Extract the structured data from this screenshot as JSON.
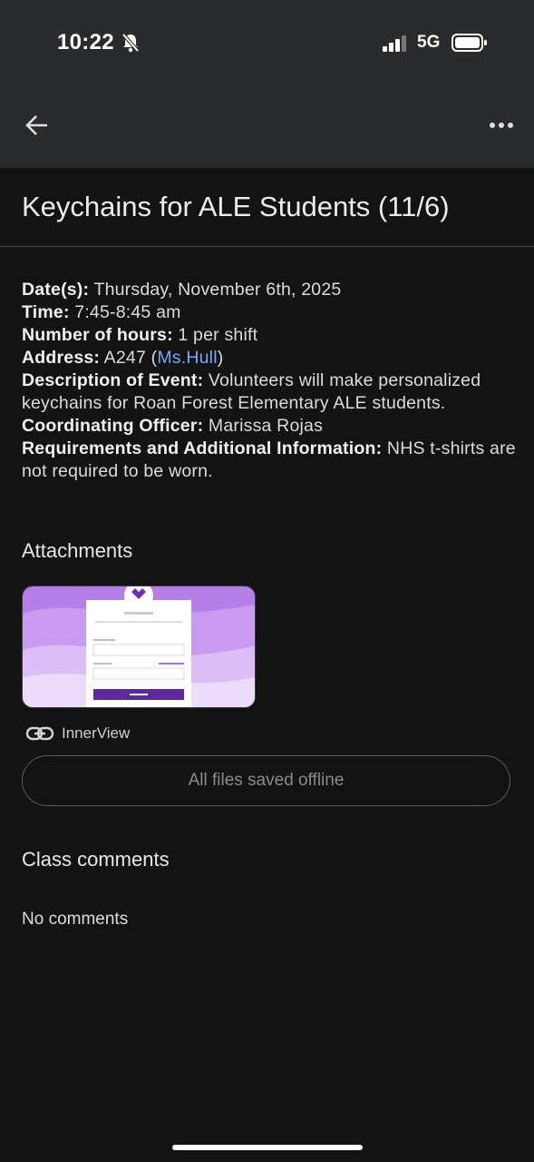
{
  "status_bar": {
    "time": "10:22",
    "network": "5G"
  },
  "header": {
    "back_icon": "arrow-left-icon",
    "more_icon": "more-horiz-icon"
  },
  "title": "Keychains for ALE Students (11/6)",
  "details": [
    {
      "label": "Date(s):",
      "value": " Thursday, November 6th, 2025"
    },
    {
      "label": "Time:",
      "value": " 7:45-8:45 am"
    },
    {
      "label": "Number of hours:",
      "value": " 1 per shift"
    },
    {
      "label": "Address:",
      "value_pre": " A247 (",
      "link": "Ms.Hull",
      "value_post": ")"
    },
    {
      "label": "Description of Event:",
      "value": " Volunteers will make personalized keychains for Roan Forest Elementary ALE students."
    },
    {
      "label": "Coordinating Officer:",
      "value": " Marissa Rojas"
    },
    {
      "label": "Requirements and Additional Information:",
      "value": " NHS t-shirts are not required to be worn."
    }
  ],
  "attachments": {
    "heading": "Attachments",
    "link_label": "InnerView",
    "link_icon": "link-icon"
  },
  "offline_button": "All files saved offline",
  "comments": {
    "heading": "Class comments",
    "empty_text": "No comments"
  },
  "colors": {
    "background": "#131313",
    "topbar": "#2a2b2d",
    "link": "#7da7f0",
    "thumb_purple": "#a46be0"
  }
}
